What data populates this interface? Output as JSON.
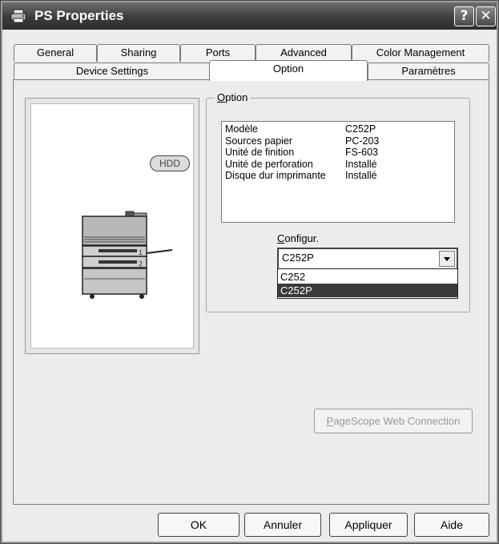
{
  "window": {
    "title": "PS Properties",
    "help_glyph": "?",
    "close_glyph": "✕"
  },
  "tabs": {
    "row1": [
      "General",
      "Sharing",
      "Ports",
      "Advanced",
      "Color Management"
    ],
    "row2": [
      "Device Settings",
      "Option",
      "Paramètres"
    ],
    "active": "Option"
  },
  "option_group": {
    "legend_mnemonic": "O",
    "legend_rest": "ption",
    "info": [
      {
        "label": "Modèle",
        "value": "C252P"
      },
      {
        "label": "Sources papier",
        "value": "PC-203"
      },
      {
        "label": "Unité de finition",
        "value": "FS-603"
      },
      {
        "label": "Unité de perforation",
        "value": "Installé"
      },
      {
        "label": "Disque dur imprimante",
        "value": "Installé"
      }
    ],
    "config_mnemonic": "C",
    "config_rest": "onfigur.",
    "config_value": "C252P",
    "config_options": [
      "C252",
      "C252P"
    ],
    "config_selected_option": "C252P"
  },
  "preview": {
    "hdd_label": "HDD",
    "tray_labels": [
      "1",
      "2"
    ]
  },
  "web_button": {
    "mnemonic": "P",
    "rest": "ageScope Web Connection"
  },
  "buttons": {
    "ok": "OK",
    "cancel": "Annuler",
    "apply": "Appliquer",
    "help": "Aide"
  }
}
